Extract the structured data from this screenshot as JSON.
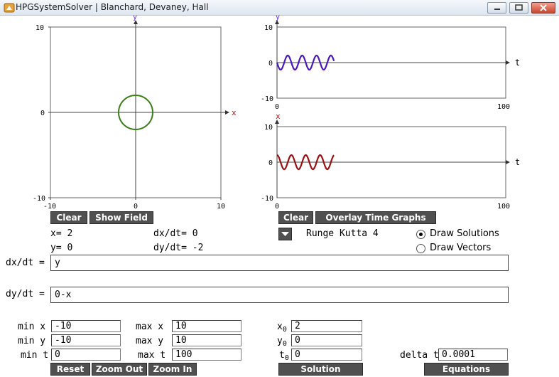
{
  "window": {
    "title": "HPGSystemSolver | Blanchard, Devaney, Hall",
    "minimize_icon": "minimize-icon",
    "maximize_icon": "maximize-icon",
    "close_icon": "close-icon"
  },
  "phase_plane": {
    "x_label": "x",
    "y_label": "y",
    "ticks": {
      "top": "10",
      "bottom": "-10",
      "left": "-10",
      "right": "10",
      "origin_x": "0",
      "origin_y": "0"
    },
    "curve_color": "#3a7d1a",
    "solution": {
      "type": "circle",
      "center": [
        0,
        0
      ],
      "radius": 2
    }
  },
  "y_time_graph": {
    "axis_label": "y",
    "t_label": "t",
    "ticks": {
      "top": "10",
      "mid": "0",
      "bottom": "-10",
      "t_start": "0",
      "t_end": "100"
    },
    "curve_color": "#4a1ab8",
    "amplitude": 2,
    "t_range": [
      0,
      25
    ]
  },
  "x_time_graph": {
    "axis_label": "x",
    "t_label": "t",
    "ticks": {
      "top": "10",
      "mid": "0",
      "bottom": "-10",
      "t_start": "0",
      "t_end": "100"
    },
    "curve_color": "#9b1010",
    "amplitude": 2,
    "t_range": [
      0,
      25
    ]
  },
  "buttons": {
    "clear_phase": "Clear",
    "show_field": "Show Field",
    "clear_time": "Clear",
    "overlay_time_graphs": "Overlay Time Graphs",
    "reset": "Reset",
    "zoom_out": "Zoom Out",
    "zoom_in": "Zoom In",
    "solution": "Solution",
    "equations": "Equations"
  },
  "readout": {
    "x": "x= 2",
    "y": "y= 0",
    "dxdt": "dx/dt= 0",
    "dydt": "dy/dt= -2"
  },
  "method": {
    "selected": "Runge Kutta 4",
    "dropdown_icon": "chevron-down-icon"
  },
  "display_mode": {
    "draw_solutions": "Draw Solutions",
    "draw_vectors": "Draw Vectors",
    "selected": "Draw Solutions"
  },
  "equations": {
    "dxdt_label": "dx/dt =",
    "dxdt_value": "y",
    "dydt_label": "dy/dt =",
    "dydt_value": "0-x"
  },
  "ranges": {
    "min_x_label": "min x",
    "min_x": "-10",
    "max_x_label": "max x",
    "max_x": "10",
    "min_y_label": "min y",
    "min_y": "-10",
    "max_y_label": "max y",
    "max_y": "10",
    "min_t_label": "min t",
    "min_t": "0",
    "max_t_label": "max t",
    "max_t": "100"
  },
  "initial": {
    "x0_label": "x",
    "x0_sub": "0",
    "x0": "2",
    "y0_label": "y",
    "y0_sub": "0",
    "y0": "0",
    "t0_label": "t",
    "t0_sub": "0",
    "t0": "0"
  },
  "delta_t": {
    "label": "delta t",
    "value": "0.0001"
  }
}
